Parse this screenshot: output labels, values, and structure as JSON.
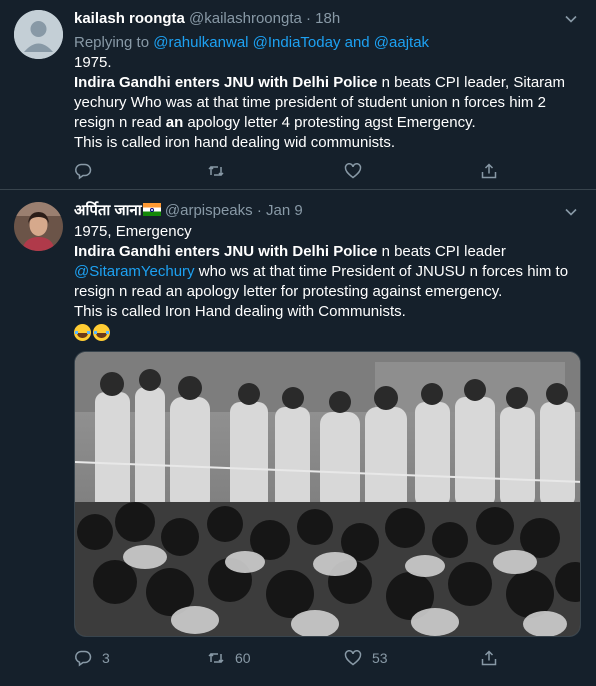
{
  "tweets": [
    {
      "name": "kailash roongta",
      "handle": "@kailashroongta",
      "separator": "·",
      "time": "18h",
      "replying_prefix": "Replying to",
      "replying_to": "@rahulkanwal @IndiaToday and @aajtak",
      "lines": [
        "1975.",
        "Indira Gandhi enters JNU with Delhi Police",
        " n beats CPI leader, Sitaram",
        "yechury Who was at that time president of student union n forces him 2",
        "resign n read ",
        "an",
        " apology letter 4 protesting agst Emergency.",
        "This is called iron hand dealing wid communists."
      ],
      "stats": {
        "reply": "",
        "retweet": "",
        "like": ""
      }
    },
    {
      "name": "अर्पिता जाना",
      "handle": "@arpispeaks",
      "separator": "·",
      "time": "Jan 9",
      "lines": [
        "1975, Emergency",
        "Indira Gandhi enters JNU with Delhi Police",
        " n beats CPI leader",
        "@SitaramYechury",
        " who ws at that time President of JNUSU n forces him to",
        "resign n read an apology letter for protesting against emergency.",
        "This is called Iron Hand dealing with Communists."
      ],
      "stats": {
        "reply": "3",
        "retweet": "60",
        "like": "53"
      },
      "photo_alt": "historic black and white photo of crowd and police"
    }
  ],
  "icons": {
    "chevron": "chevron-down-icon",
    "reply": "reply-icon",
    "retweet": "retweet-icon",
    "like": "heart-icon",
    "share": "share-icon",
    "flag": "india-flag-icon",
    "emoji": "laughing-emoji-icon"
  },
  "colors": {
    "background": "#15202b",
    "text": "#ffffff",
    "muted": "#8899a6",
    "link": "#1da1f2",
    "border": "#38444d"
  }
}
